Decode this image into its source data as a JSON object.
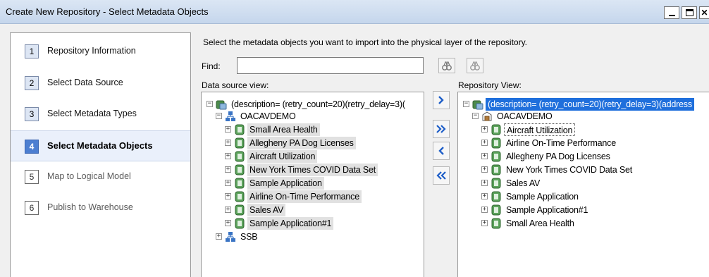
{
  "window": {
    "title": "Create New Repository - Select Metadata Objects"
  },
  "steps": [
    {
      "num": "1",
      "label": "Repository Information",
      "state": "done"
    },
    {
      "num": "2",
      "label": "Select Data Source",
      "state": "done"
    },
    {
      "num": "3",
      "label": "Select Metadata Types",
      "state": "done"
    },
    {
      "num": "4",
      "label": "Select Metadata Objects",
      "state": "active"
    },
    {
      "num": "5",
      "label": "Map to Logical Model",
      "state": "todo"
    },
    {
      "num": "6",
      "label": "Publish to Warehouse",
      "state": "todo"
    }
  ],
  "instruction": "Select the metadata objects you want to import into the physical layer of the repository.",
  "find": {
    "label": "Find:",
    "value": ""
  },
  "data_source": {
    "label": "Data source view:",
    "root": "(description= (retry_count=20)(retry_delay=3)(",
    "db": "OACAVDEMO",
    "items": [
      "Small Area Health",
      "Allegheny PA Dog Licenses",
      "Aircraft Utilization",
      "New York Times COVID Data Set",
      "Sample Application",
      "Airline On-Time Performance",
      "Sales AV",
      "Sample Application#1"
    ],
    "db2": "SSB"
  },
  "repository": {
    "label": "Repository View:",
    "root": "(description= (retry_count=20)(retry_delay=3)(address",
    "db": "OACAVDEMO",
    "items": [
      "Aircraft Utilization",
      "Airline On-Time Performance",
      "Allegheny PA Dog Licenses",
      "New York Times COVID Data Set",
      "Sales AV",
      "Sample Application",
      "Sample Application#1",
      "Small Area Health"
    ]
  },
  "colors": {
    "active_step": "#4d7fd1",
    "selection": "#1f6fdc",
    "arrow": "#1f5fc8"
  }
}
